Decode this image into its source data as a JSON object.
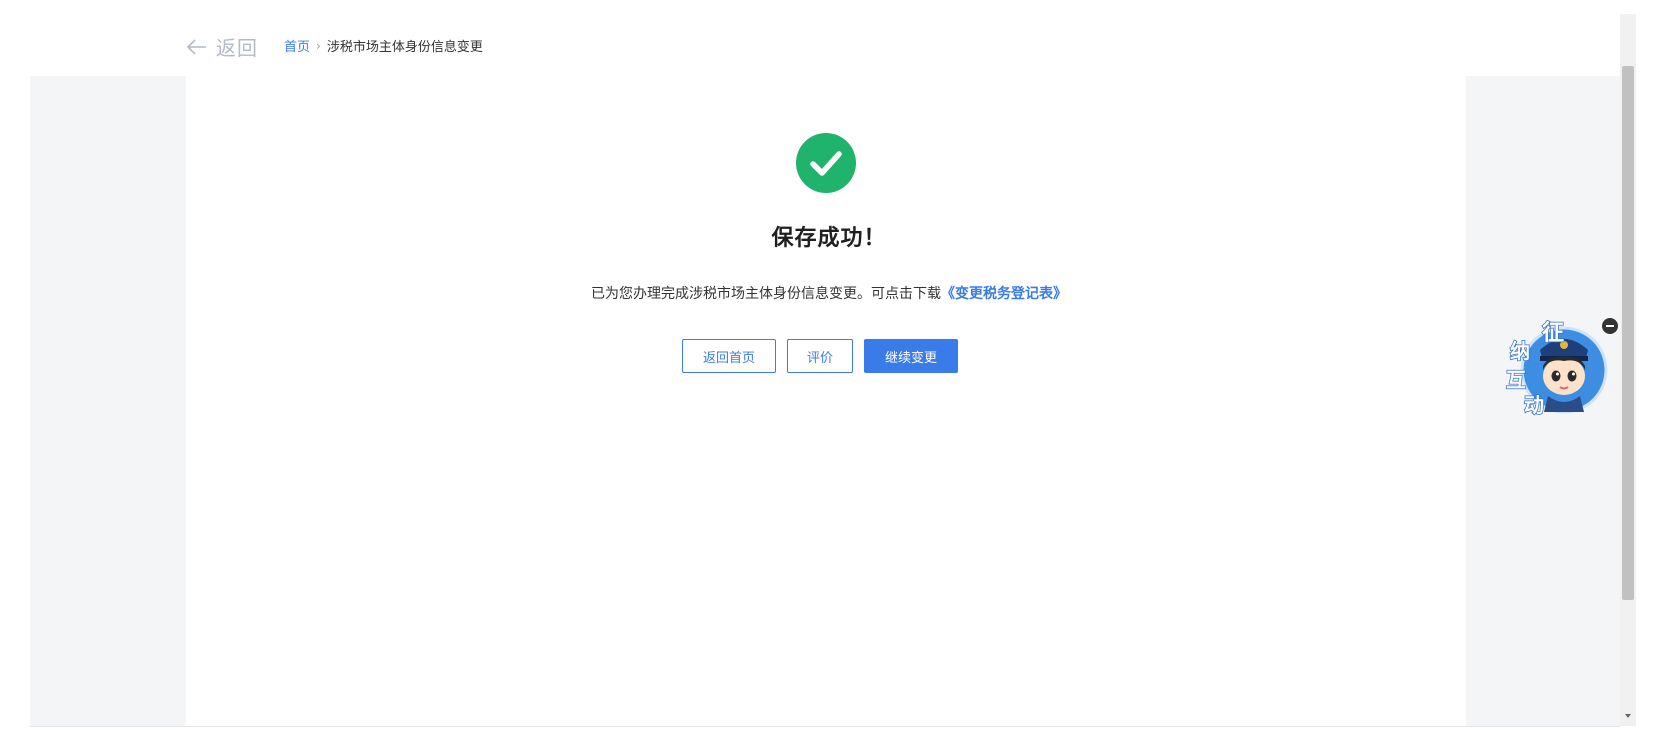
{
  "nav": {
    "back_label": "返回",
    "breadcrumb_home": "首页",
    "breadcrumb_current": "涉税市场主体身份信息变更"
  },
  "result": {
    "title": "保存成功！",
    "message": "已为您办理完成涉税市场主体身份信息变更。可点击下载",
    "download_link": "《变更税务登记表》"
  },
  "actions": {
    "home_label": "返回首页",
    "rate_label": "评价",
    "continue_label": "继续变更"
  },
  "assistant": {
    "chars": [
      "征",
      "纳",
      "互",
      "动"
    ]
  },
  "colors": {
    "accent": "#3a7bea",
    "success": "#1fb36b",
    "gray_bg": "#f4f5f7"
  }
}
